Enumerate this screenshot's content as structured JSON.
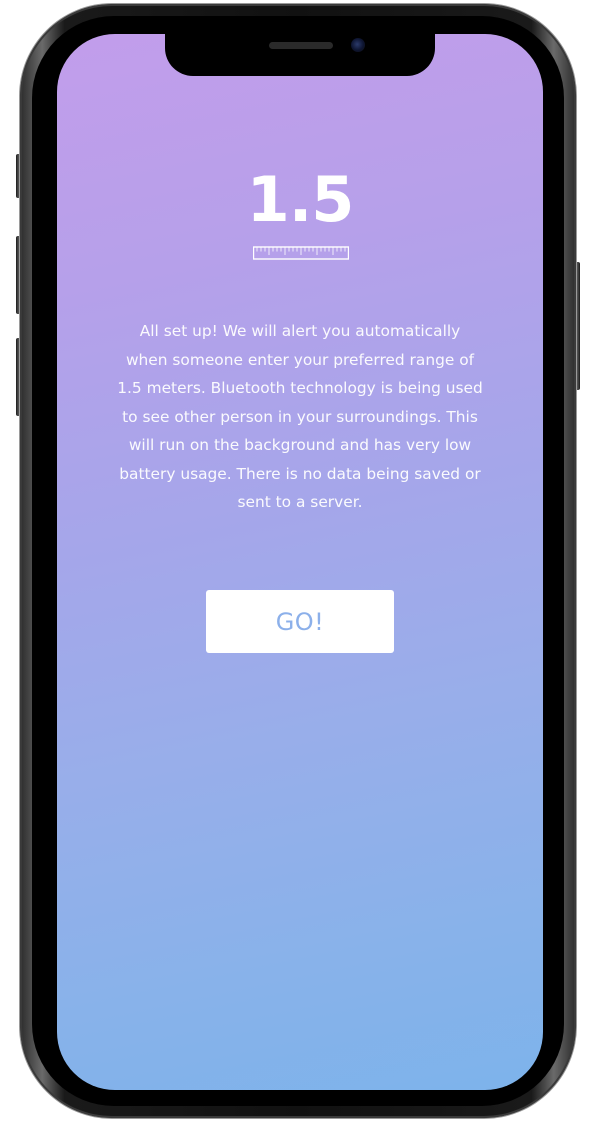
{
  "screen": {
    "range_value": "1.5",
    "ruler_icon": "ruler-icon",
    "message": "All set up! We will alert you automatically when someone enter your preferred range of 1.5 meters. Bluetooth technology is being used to see other person in your surroundings. This will run on the background and has very low battery usage. There is no data being saved or sent to a server.",
    "go_button_label": "GO!"
  },
  "colors": {
    "gradient_top": "#c29deb",
    "gradient_bottom": "#7db3eb",
    "button_text": "#8cb0ea",
    "text": "#ffffff"
  }
}
